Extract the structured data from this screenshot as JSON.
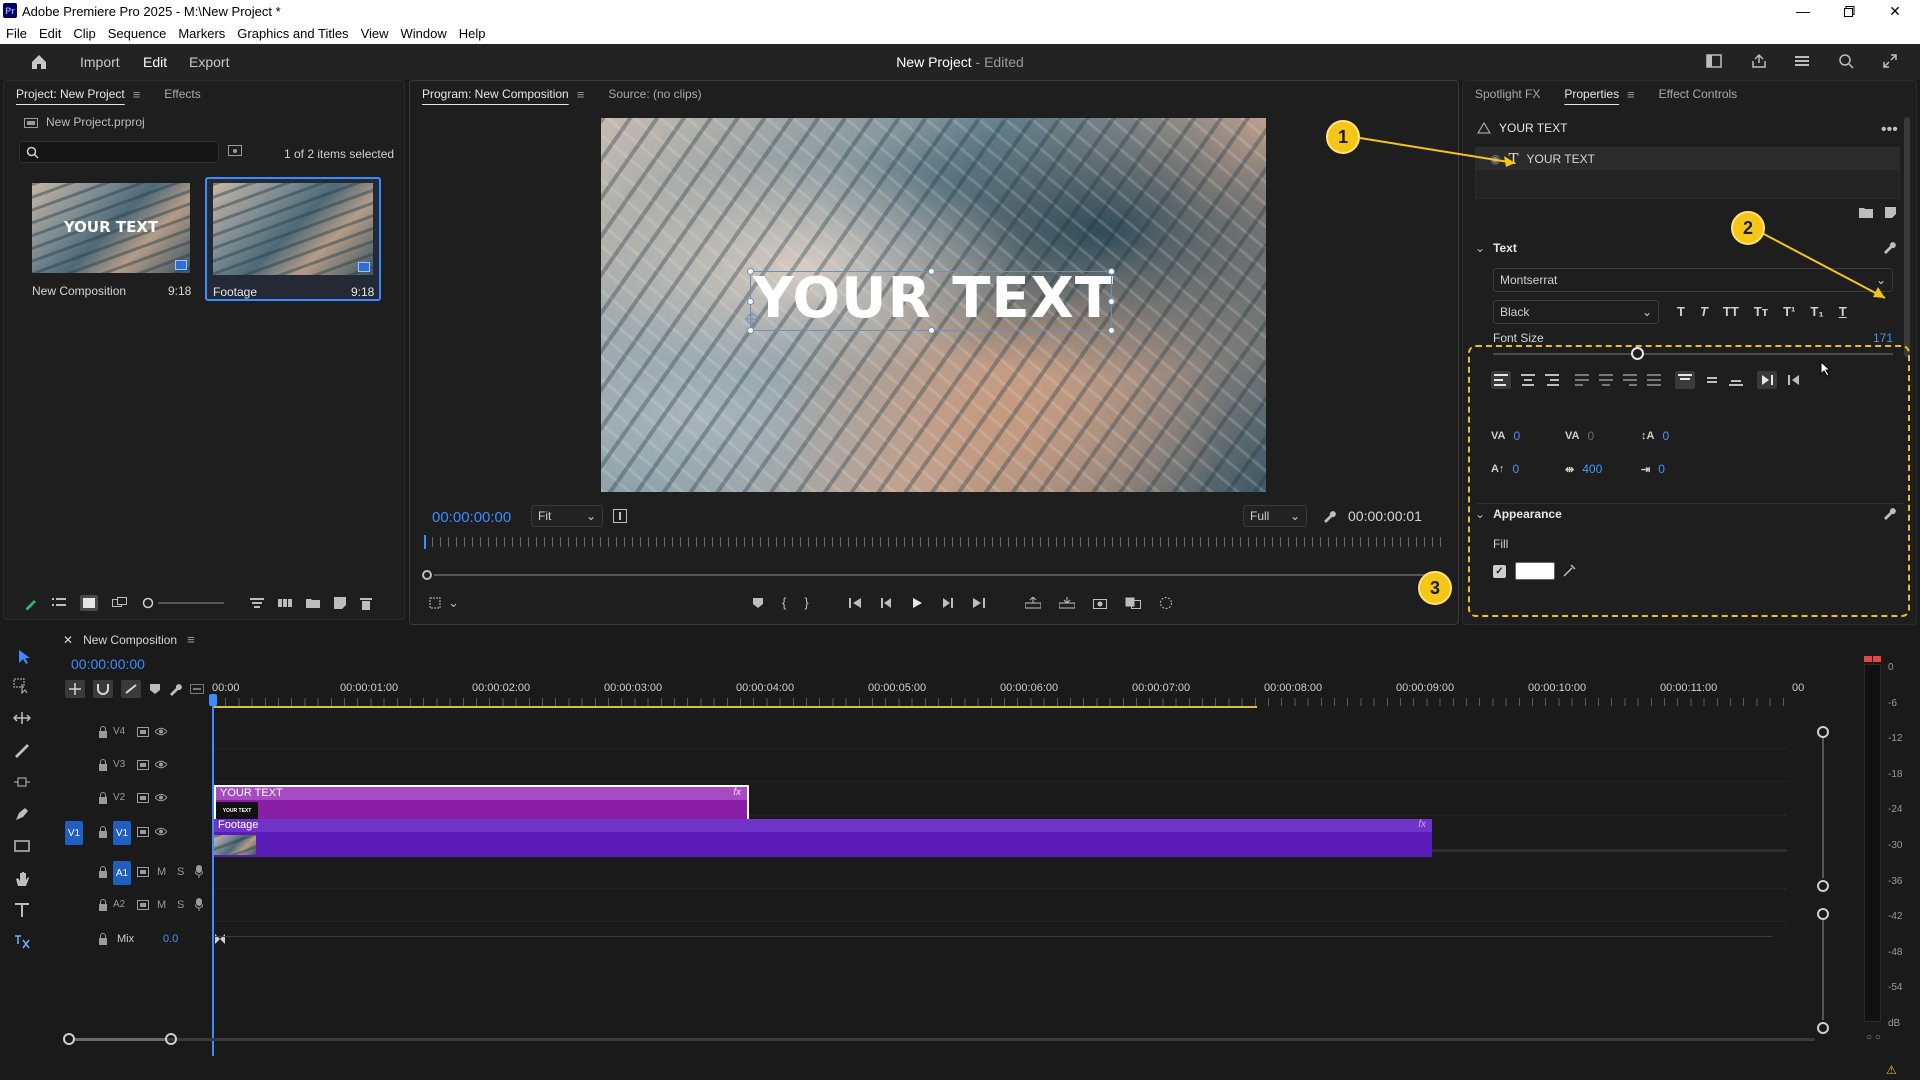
{
  "window": {
    "title": "Adobe Premiere Pro 2025 - M:\\New Project *",
    "app_badge": "Pr",
    "controls": [
      "minimize",
      "maximize",
      "close"
    ]
  },
  "menu": [
    "File",
    "Edit",
    "Clip",
    "Sequence",
    "Markers",
    "Graphics and Titles",
    "View",
    "Window",
    "Help"
  ],
  "header": {
    "nav": [
      "Import",
      "Edit",
      "Export"
    ],
    "active_nav": "Edit",
    "doc_title": "New Project",
    "doc_status": "- Edited"
  },
  "project_panel": {
    "tabs": [
      "Project: New Project",
      "Effects"
    ],
    "file": "New Project.prproj",
    "search_placeholder": "",
    "selection_status": "1 of 2 items selected",
    "items": [
      {
        "name": "New Composition",
        "duration": "9:18",
        "overlay": "YOUR TEXT",
        "selected": false
      },
      {
        "name": "Footage",
        "duration": "9:18",
        "overlay": "",
        "selected": true
      }
    ]
  },
  "program_monitor": {
    "tabs": [
      "Program: New Composition",
      "Source: (no clips)"
    ],
    "overlay_text": "YOUR TEXT",
    "timecode_current": "00:00:00:00",
    "fit": "Fit",
    "quality": "Full",
    "timecode_duration": "00:00:00:01"
  },
  "properties_panel": {
    "tabs": [
      "Spotlight FX",
      "Properties",
      "Effect Controls"
    ],
    "active_tab": "Properties",
    "layer_name": "YOUR TEXT",
    "text_layer": "YOUR TEXT",
    "text_section": "Text",
    "font": "Montserrat",
    "font_style": "Black",
    "format_buttons": [
      "T",
      "T",
      "TT",
      "Tт",
      "T¹",
      "T₁",
      "T"
    ],
    "font_size_label": "Font Size",
    "font_size_value": "171",
    "font_size_fraction": 0.36,
    "metrics": {
      "kerning": "0",
      "tracking": "0",
      "leading": "0",
      "baseline": "0",
      "tsume": "400",
      "tab": "0"
    },
    "appearance_section": "Appearance",
    "fill_label": "Fill",
    "fill_color": "#ffffff"
  },
  "callouts": [
    "1",
    "2",
    "3"
  ],
  "timeline": {
    "sequence_name": "New Composition",
    "timecode": "00:00:00:00",
    "ruler": [
      "00:00",
      "00:00:01:00",
      "00:00:02:00",
      "00:00:03:00",
      "00:00:04:00",
      "00:00:05:00",
      "00:00:06:00",
      "00:00:07:00",
      "00:00:08:00",
      "00:00:09:00",
      "00:00:10:00",
      "00:00:11:00",
      "00"
    ],
    "tracks": [
      {
        "id": "V4",
        "label": "V4"
      },
      {
        "id": "V3",
        "label": "V3"
      },
      {
        "id": "V2",
        "label": "V2"
      },
      {
        "id": "V1",
        "label": "V1",
        "source": "V1"
      },
      {
        "id": "A1",
        "label": "A1",
        "m": "M",
        "s": "S"
      },
      {
        "id": "A2",
        "label": "A2",
        "m": "M",
        "s": "S"
      }
    ],
    "mix_label": "Mix",
    "mix_value": "0.0",
    "clips": [
      {
        "name": "YOUR TEXT",
        "thumb_text": "YOUR TEXT",
        "track": "V2",
        "fx": "fx"
      },
      {
        "name": "Footage",
        "track": "V1",
        "fx": "fx"
      }
    ]
  },
  "audio_meter": {
    "labels": [
      "0",
      "-6",
      "-12",
      "-18",
      "-24",
      "-30",
      "-36",
      "-42",
      "-48",
      "-54",
      "dB"
    ],
    "footer": "○ ○"
  },
  "colors": {
    "accent_blue": "#3c8cff",
    "text_clip": "#8a1fa6",
    "footage_clip": "#5b1bb8",
    "callout": "#f5c518"
  }
}
